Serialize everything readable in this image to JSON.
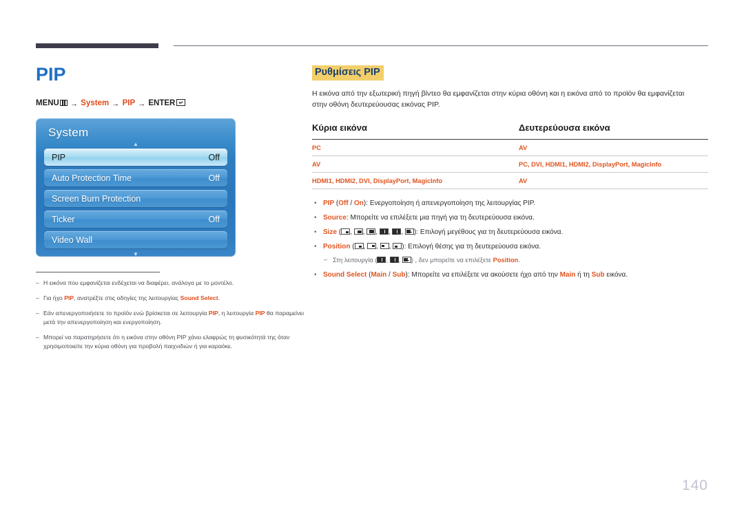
{
  "header": {
    "rule_left_color": "#3f3b4a",
    "rule_right_color": "#6e6a78"
  },
  "left": {
    "title": "PIP",
    "breadcrumb": {
      "menu_label": "MENU",
      "arrow": "→",
      "step1": "System",
      "step2": "PIP",
      "enter_label": "ENTER"
    },
    "osd": {
      "panel_title": "System",
      "up_arrow": "▲",
      "down_arrow": "▼",
      "rows": [
        {
          "label": "PIP",
          "value": "Off",
          "selected": true
        },
        {
          "label": "Auto Protection Time",
          "value": "Off",
          "selected": false
        },
        {
          "label": "Screen Burn Protection",
          "value": "",
          "selected": false
        },
        {
          "label": "Ticker",
          "value": "Off",
          "selected": false
        },
        {
          "label": "Video Wall",
          "value": "",
          "selected": false
        }
      ]
    },
    "notes": [
      {
        "dash": "–",
        "parts": [
          {
            "t": "Η εικόνα που εμφανίζεται ενδέχεται να διαφέρει, ανάλογα με το μοντέλο.",
            "hl": false
          }
        ]
      },
      {
        "dash": "–",
        "parts": [
          {
            "t": "Για ήχο ",
            "hl": false
          },
          {
            "t": "PIP",
            "hl": true
          },
          {
            "t": ", ανατρέξτε στις οδηγίες της λειτουργίας ",
            "hl": false
          },
          {
            "t": "Sound Select",
            "hl": true
          },
          {
            "t": ".",
            "hl": false
          }
        ]
      },
      {
        "dash": "–",
        "parts": [
          {
            "t": "Εάν απενεργοποιήσετε το προϊόν ενώ βρίσκεται σε λειτουργία ",
            "hl": false
          },
          {
            "t": "PIP",
            "hl": true
          },
          {
            "t": ", η λειτουργία ",
            "hl": false
          },
          {
            "t": "PIP",
            "hl": true
          },
          {
            "t": " θα παραμείνει μετά την απενεργοποίηση και ενεργοποίηση.",
            "hl": false
          }
        ]
      },
      {
        "dash": "–",
        "parts": [
          {
            "t": "Μπορεί να παρατηρήσετε ότι η εικόνα στην οθόνη PIP χάνει ελαφρώς τη φυσικότητά της όταν χρησιμοποιείτε την κύρια οθόνη για προβολή παιχνιδιών ή για καραόκε.",
            "hl": false
          }
        ]
      }
    ]
  },
  "right": {
    "section_title": "Ρυθμίσεις PIP",
    "section_title_bg": "#f2cf6a",
    "section_title_color": "#1b3f6e",
    "description": "Η εικόνα από την εξωτερική πηγή βίντεο θα εμφανίζεται στην κύρια οθόνη και η εικόνα από το προϊόν θα εμφανίζεται στην οθόνη δευτερεύουσας εικόνας PIP.",
    "table": {
      "headers": [
        "Κύρια εικόνα",
        "Δευτερεύουσα εικόνα"
      ],
      "rows": [
        [
          "PC",
          "AV"
        ],
        [
          "AV",
          "PC, DVI, HDMI1, HDMI2, DisplayPort, MagicInfo"
        ],
        [
          "HDMI1, HDMI2, DVI, DisplayPort, MagicInfo",
          "AV"
        ]
      ]
    },
    "bullets": {
      "pip": {
        "name": "PIP",
        "open_paren": " (",
        "opt_off": "Off",
        "slash": " / ",
        "opt_on": "On",
        "close": "): ",
        "text": "Ενεργοποίηση ή απενεργοποίηση της λειτουργίας PIP."
      },
      "source": {
        "name": "Source",
        "sep": ": ",
        "text": "Μπορείτε να επιλέξετε μια πηγή για τη δευτερεύουσα εικόνα."
      },
      "size": {
        "name": "Size",
        "open": " (",
        "close": "): ",
        "text": "Επιλογή μεγέθους για τη δευτερεύουσα εικόνα.",
        "icons": [
          "pip-size-small",
          "pip-size-medium",
          "pip-size-large",
          "pip-split-half",
          "pip-split-wide",
          "pip-split-bar"
        ]
      },
      "position": {
        "name": "Position",
        "open": " (",
        "close": "): ",
        "text": "Επιλογή θέσης για τη δευτερεύουσα εικόνα.",
        "icons": [
          "pip-pos-bottom-right",
          "pip-pos-top-right",
          "pip-pos-top-left",
          "pip-pos-bottom-left"
        ]
      },
      "subnote": {
        "dash": "–",
        "pre": "Στη λειτουργία (",
        "mid": ") , δεν μπορείτε να επιλέξετε ",
        "hl": "Position",
        "post": ".",
        "icons": [
          "pip-split-half",
          "pip-split-wide",
          "pip-split-bar"
        ]
      },
      "sound_select": {
        "name": "Sound Select",
        "open": " (",
        "main": "Main",
        "slash": " / ",
        "sub": "Sub",
        "close": "): ",
        "text_a": "Μπορείτε να επιλέξετε να ακούσετε ήχο από την ",
        "main2": "Main",
        "text_b": " ή τη ",
        "sub2": "Sub",
        "text_c": " εικόνα."
      }
    }
  },
  "footer": {
    "page_number": "140"
  },
  "colors": {
    "accent_orange": "#e0541f",
    "title_blue": "#1f6fc4",
    "highlight_yellow": "#f2cf6a"
  }
}
